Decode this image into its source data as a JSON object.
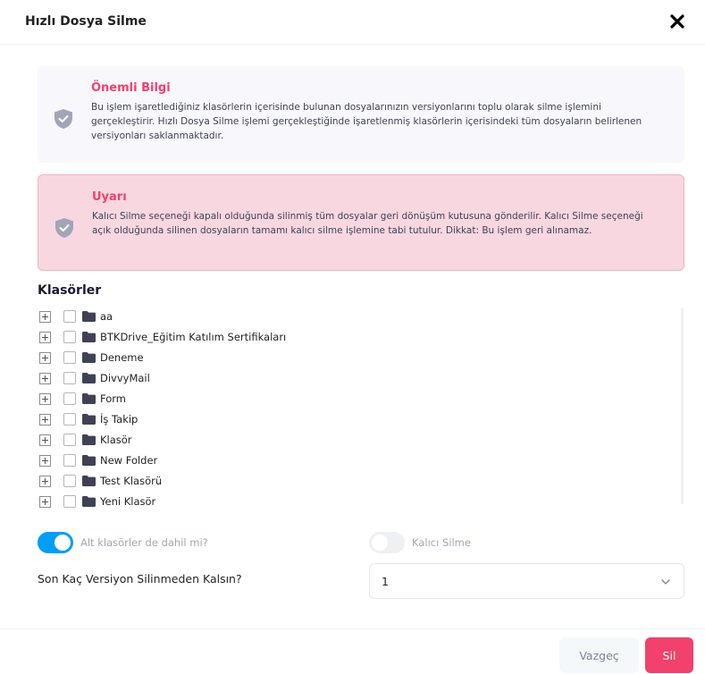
{
  "dialog": {
    "title": "Hızlı Dosya Silme"
  },
  "info_alert": {
    "title": "Önemli Bilgi",
    "text": "Bu işlem işaretlediğiniz klasörlerin içerisinde bulunan dosyalarınızın versiyonlarını toplu olarak silme işlemini gerçekleştirir. Hızlı Dosya Silme işlemi gerçekleştiğinde işaretlenmiş klasörlerin içerisindeki tüm dosyaların belirlenen versiyonları saklanmaktadır."
  },
  "warning_alert": {
    "title": "Uyarı",
    "text": "Kalıcı Silme seçeneği kapalı olduğunda silinmiş tüm dosyalar geri dönüşüm kutusuna gönderilir. Kalıcı Silme seçeneği açık olduğunda silinen dosyaların tamamı kalıcı silme işlemine tabi tutulur. Dikkat: Bu işlem geri alınamaz."
  },
  "folders": {
    "title": "Klasörler",
    "items": [
      {
        "label": "aa"
      },
      {
        "label": "BTKDrive_Eğitim Katılım Sertifikaları"
      },
      {
        "label": "Deneme"
      },
      {
        "label": "DivvyMail"
      },
      {
        "label": "Form"
      },
      {
        "label": "İş Takip"
      },
      {
        "label": "Klasör"
      },
      {
        "label": "New Folder"
      },
      {
        "label": "Test Klasörü"
      },
      {
        "label": "Yeni Klasör"
      }
    ]
  },
  "options": {
    "include_subfolders": {
      "label": "Alt klasörler de dahil mi?",
      "on": true
    },
    "permanent_delete": {
      "label": "Kalıcı Silme",
      "on": false
    }
  },
  "versions": {
    "label": "Son Kaç Versiyon Silinmeden Kalsın?",
    "value": "1"
  },
  "buttons": {
    "cancel": "Vazgeç",
    "delete": "Sil"
  },
  "colors": {
    "accent": "#009ef7",
    "danger": "#f1416c",
    "warning_bg": "#f8d7e0",
    "info_bg": "#f8f7fc"
  },
  "icons": {
    "close": "close-icon",
    "alert": "shield-check-icon",
    "folder": "folder-icon",
    "expand": "plus-square-icon",
    "select": "chevron-down-icon"
  }
}
